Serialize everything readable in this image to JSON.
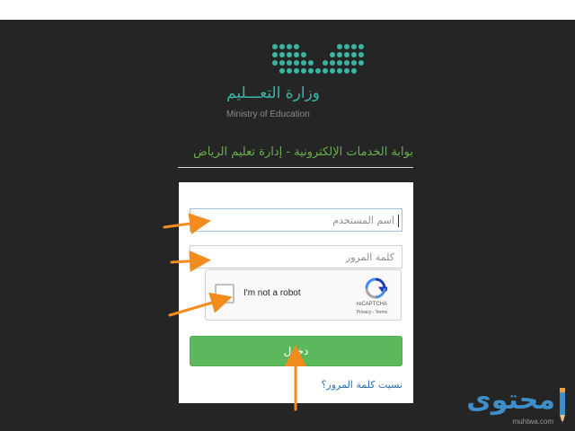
{
  "brand": {
    "ministry_ar": "وزارة التعـــليم",
    "ministry_en": "Ministry of Education",
    "accent_color": "#3ab5a4"
  },
  "portal": {
    "title": "بوابة الخدمات الإلكترونية - إدارة تعليم الرياض",
    "title_color": "#6ab04c"
  },
  "form": {
    "username_placeholder": "اسم المستخدم",
    "password_placeholder": "كلمة المرور",
    "login_label": "دخول",
    "login_color": "#5cb85c",
    "forgot_label": "نسيت كلمة المرور؟"
  },
  "recaptcha": {
    "label": "I'm not a robot",
    "brand": "reCAPTCHA",
    "links": "Privacy - Terms"
  },
  "watermark": {
    "text": "محتوى",
    "url": "muhtwa.com"
  },
  "annotation_color": "#f28c1e"
}
